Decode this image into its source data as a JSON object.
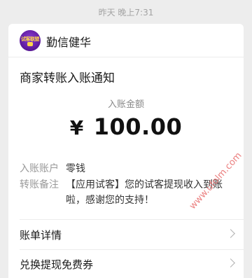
{
  "timestamp": "昨天 晚上7:31",
  "header": {
    "brand_name": "勤信健华",
    "avatar_text": "试客联盟"
  },
  "message": {
    "title": "商家转账入账通知",
    "amount_label": "入账金额",
    "currency": "¥",
    "amount": "100.00",
    "account_label": "入账账户",
    "account_value": "零钱",
    "remark_label": "转账备注",
    "remark_value": "【应用试客】您的试客提现收入到账啦，感谢您的支持！"
  },
  "links": [
    {
      "label": "账单详情"
    },
    {
      "label": "兑换提现免费券"
    }
  ],
  "watermark": "www.ufolm.com",
  "colors": {
    "background": "#ededed",
    "card": "#ffffff",
    "watermark": "#e86a6a"
  }
}
